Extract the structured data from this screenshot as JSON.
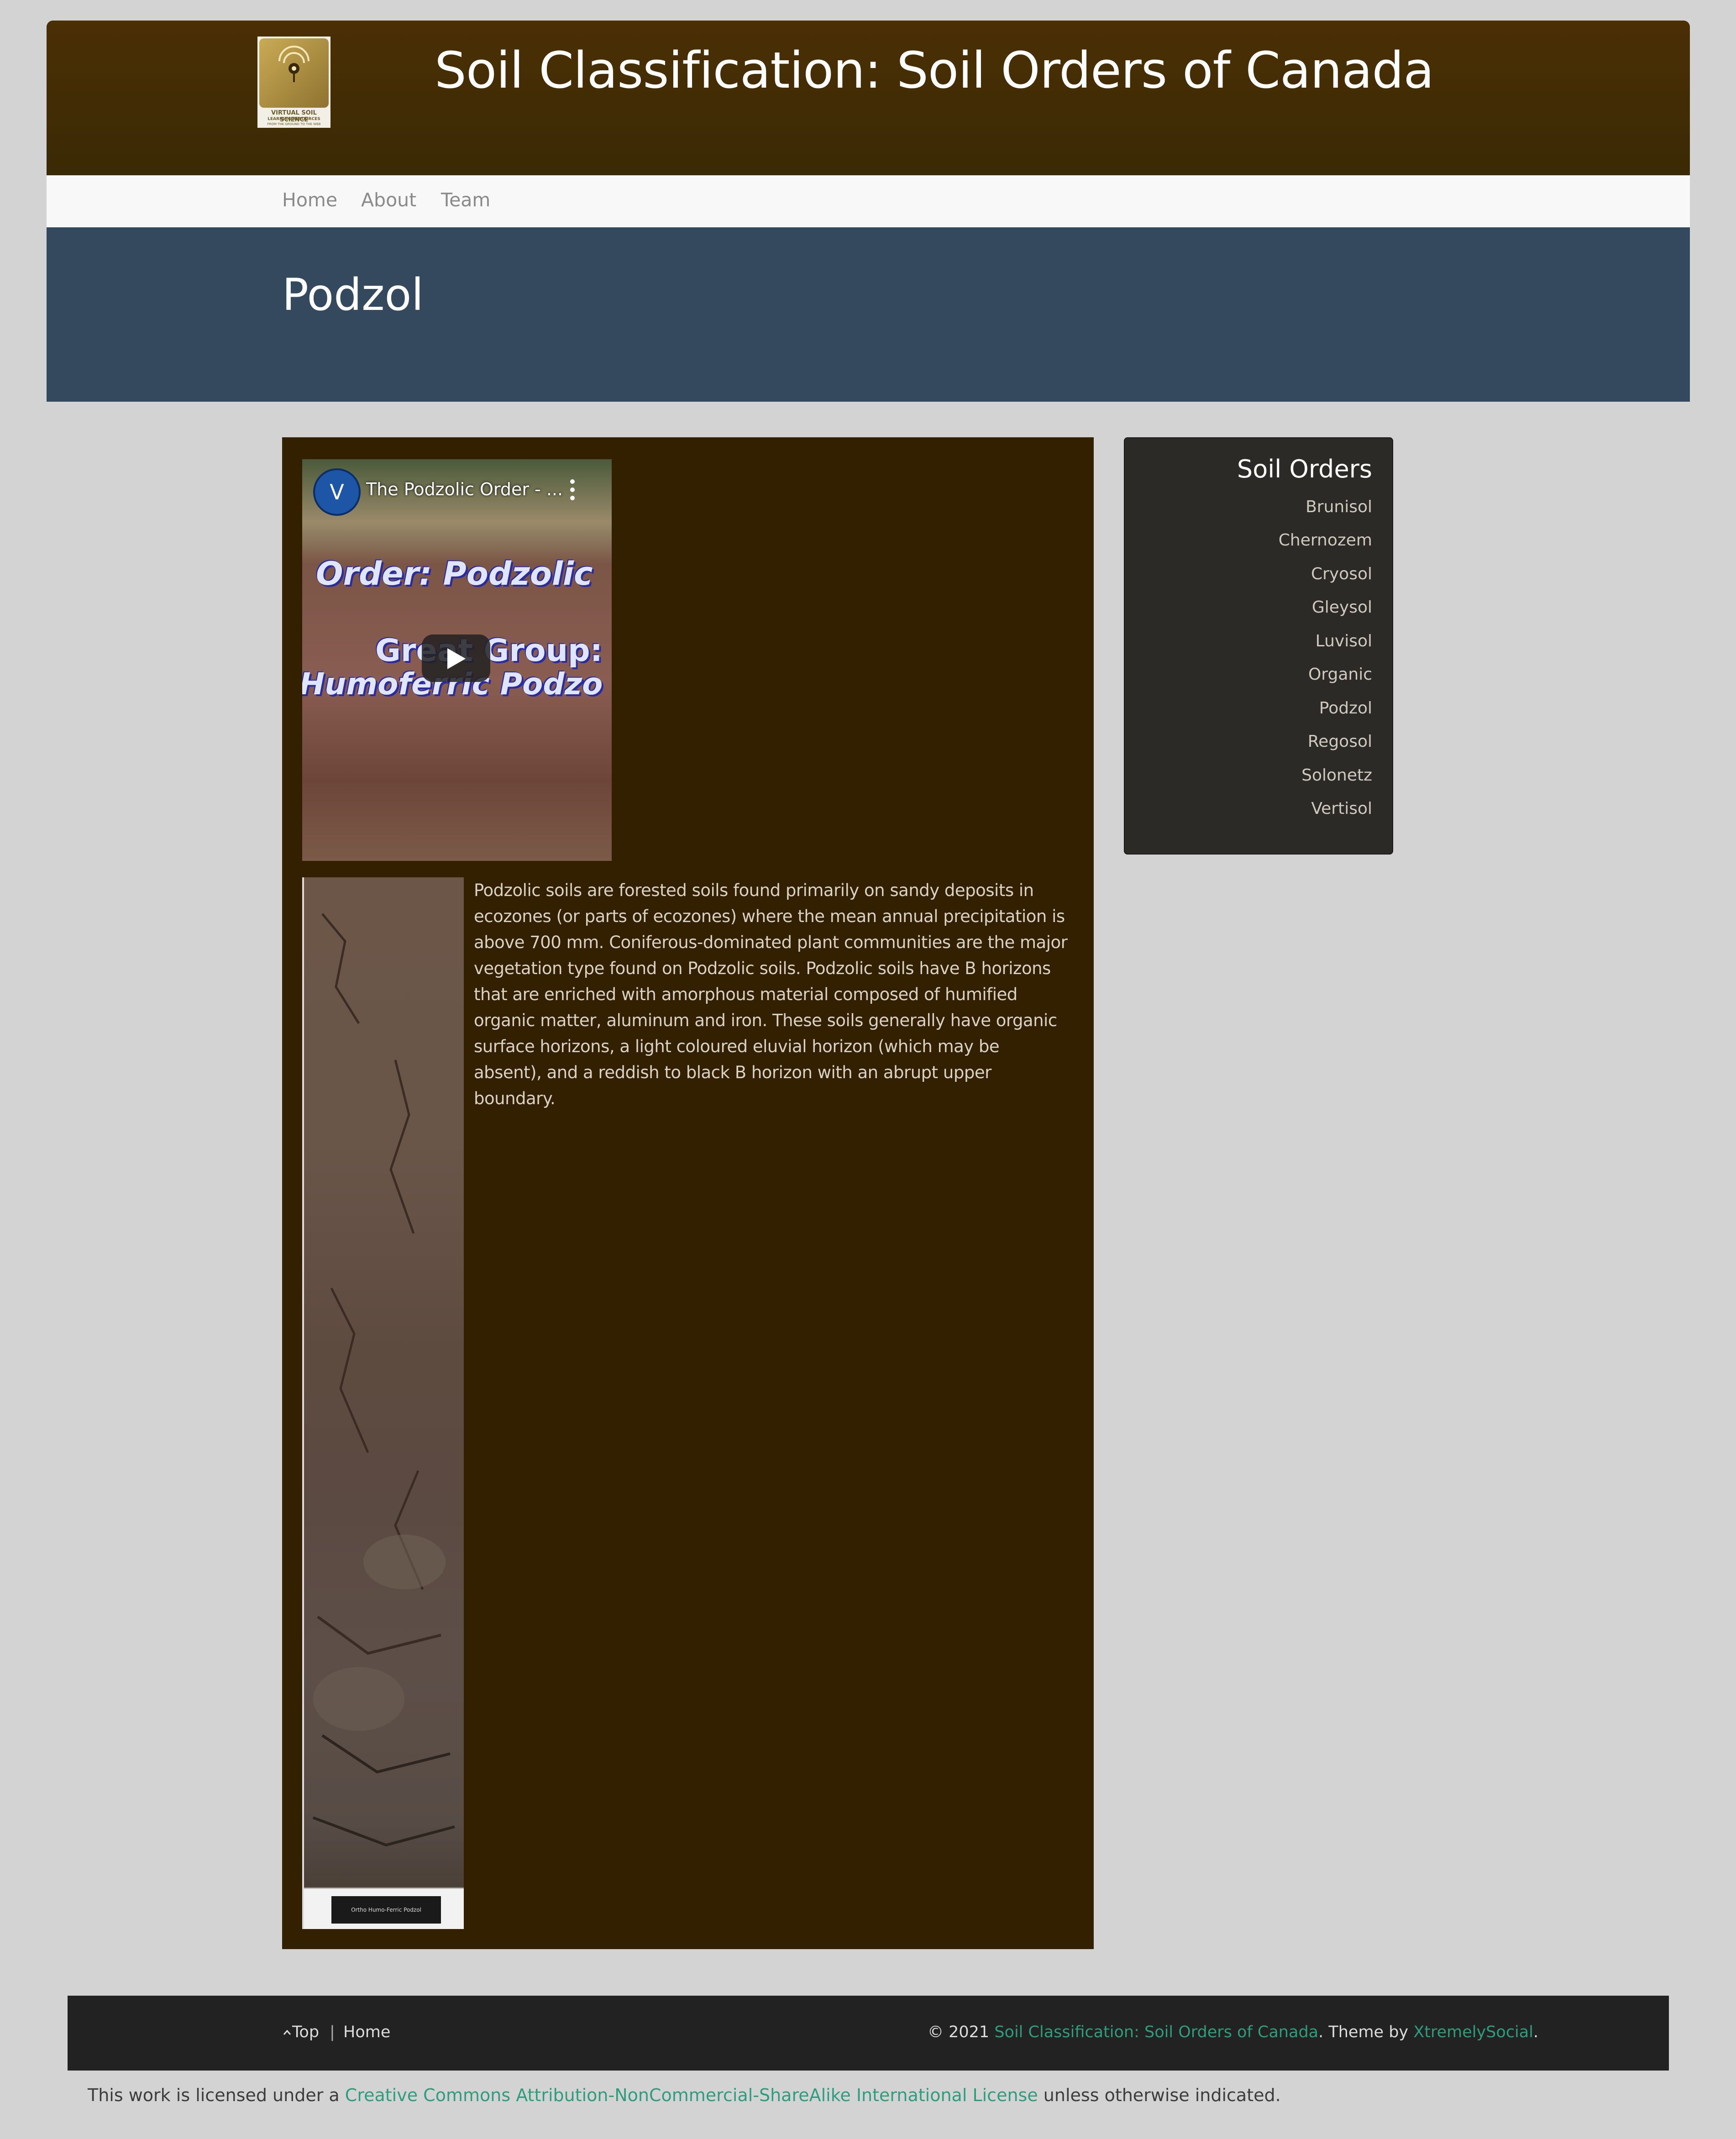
{
  "site": {
    "title": "Soil Classification: Soil Orders of Canada",
    "logo_line1": "VIRTUAL SOIL SCIENCE",
    "logo_line2": "LEARNING RESOURCES",
    "logo_line3": "FROM THE GROUND TO THE WEB"
  },
  "nav": {
    "items": [
      {
        "label": "Home"
      },
      {
        "label": "About"
      },
      {
        "label": "Team"
      }
    ]
  },
  "page": {
    "title": "Podzol"
  },
  "video": {
    "channel_initial": "V",
    "title": "The Podzolic Order - ...",
    "overlay_line1": "Order:  Podzolic",
    "overlay_line2": "Great Group:",
    "overlay_line3": "Humoferric Podzo"
  },
  "profile_image": {
    "caption": "Ortho Humo-Ferric Podzol"
  },
  "content": {
    "description": "Podzolic soils are forested soils found primarily on sandy deposits in ecozones (or parts of ecozones) where the mean annual precipitation is above 700 mm. Coniferous-dominated plant communities are the major vegetation type found on Podzolic soils. Podzolic soils have B horizons that are enriched with amorphous material composed of humified organic matter, aluminum and iron. These soils generally have organic surface horizons, a light coloured eluvial horizon (which may be absent), and a reddish to black B horizon with an abrupt upper boundary."
  },
  "sidebar": {
    "title": "Soil Orders",
    "items": [
      {
        "label": "Brunisol"
      },
      {
        "label": "Chernozem"
      },
      {
        "label": "Cryosol"
      },
      {
        "label": "Gleysol"
      },
      {
        "label": "Luvisol"
      },
      {
        "label": "Organic"
      },
      {
        "label": "Podzol"
      },
      {
        "label": "Regosol"
      },
      {
        "label": "Solonetz"
      },
      {
        "label": "Vertisol"
      }
    ]
  },
  "footer": {
    "top_label": "Top",
    "separator": "|",
    "home_label": "Home",
    "copyright_prefix": "© 2021 ",
    "site_link": "Soil Classification: Soil Orders of Canada",
    "theme_text": ". Theme by ",
    "theme_link": "XtremelySocial",
    "theme_suffix": "."
  },
  "license": {
    "prefix": "This work is licensed under a ",
    "link": "Creative Commons Attribution-NonCommercial-ShareAlike International License",
    "suffix": " unless otherwise indicated."
  },
  "colors": {
    "header_brown": "#4b2f05",
    "title_band": "#34495e",
    "main_panel": "#332000",
    "sidebar_bg": "#2c2a26",
    "footer_bg": "#222222",
    "link_green": "#2e9e7a"
  }
}
